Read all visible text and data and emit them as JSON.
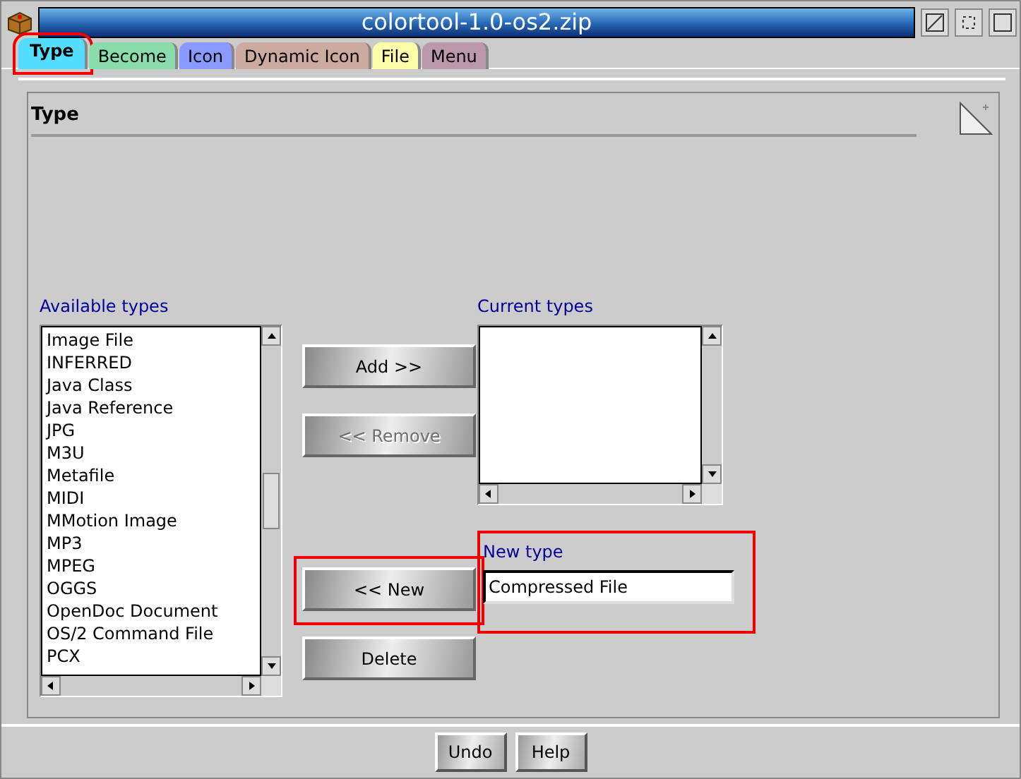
{
  "window": {
    "title": "colortool-1.0-os2.zip"
  },
  "tabs": [
    {
      "label": "Type",
      "selected": true,
      "color": "#55ddff",
      "highlighted": true
    },
    {
      "label": "Become",
      "selected": false,
      "color": "#88ddaa",
      "highlighted": false
    },
    {
      "label": "Icon",
      "selected": false,
      "color": "#8899ff",
      "highlighted": false
    },
    {
      "label": "Dynamic Icon",
      "selected": false,
      "color": "#ccaaa0",
      "highlighted": false
    },
    {
      "label": "File",
      "selected": false,
      "color": "#ffffaa",
      "highlighted": false
    },
    {
      "label": "Menu",
      "selected": false,
      "color": "#bb99aa",
      "highlighted": false
    }
  ],
  "page": {
    "heading": "Type",
    "available": {
      "label": "Available types",
      "items": [
        "Image File",
        "INFERRED",
        "Java Class",
        "Java Reference",
        "JPG",
        "M3U",
        "Metafile",
        "MIDI",
        "MMotion Image",
        "MP3",
        "MPEG",
        "OGGS",
        "OpenDoc Document",
        "OS/2 Command File",
        "PCX"
      ]
    },
    "current": {
      "label": "Current types"
    },
    "buttons": [
      {
        "label": "Add >>",
        "disabled": false,
        "highlighted": false
      },
      {
        "label": "<< Remove",
        "disabled": true,
        "highlighted": false
      },
      {
        "label": "<< New",
        "disabled": false,
        "highlighted": true
      },
      {
        "label": "Delete",
        "disabled": false,
        "highlighted": false
      }
    ],
    "new_type": {
      "label": "New type",
      "value": "Compressed File",
      "highlighted": true
    }
  },
  "footer_buttons": [
    "Undo",
    "Help"
  ]
}
